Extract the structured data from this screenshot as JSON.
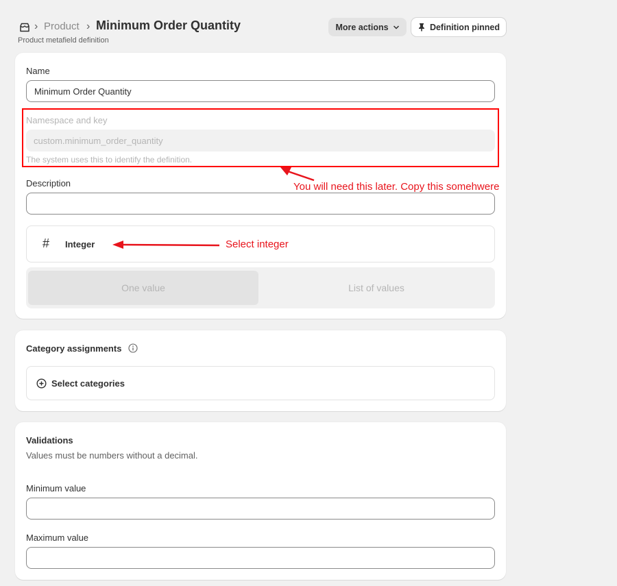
{
  "header": {
    "breadcrumb": "Product",
    "title": "Minimum Order Quantity",
    "subtitle": "Product metafield definition",
    "more_actions": "More actions",
    "pin_button": "Definition pinned"
  },
  "definition": {
    "name_label": "Name",
    "name_value": "Minimum Order Quantity",
    "namespace_label": "Namespace and key",
    "namespace_value": "custom.minimum_order_quantity",
    "namespace_help": "The system uses this to identify the definition.",
    "description_label": "Description",
    "description_value": "",
    "type_label": "Integer",
    "option_one": "One value",
    "option_list": "List of values"
  },
  "category": {
    "title": "Category assignments",
    "select_label": "Select categories"
  },
  "validations": {
    "title": "Validations",
    "description": "Values must be numbers without a decimal.",
    "min_label": "Minimum value",
    "min_value": "",
    "max_label": "Maximum value",
    "max_value": ""
  },
  "annotations": {
    "copy_note": "You will need this later. Copy this somehwere",
    "select_note": "Select integer",
    "color": "#e8141c"
  },
  "icons": {
    "store": "store-icon",
    "pin": "pin-icon",
    "chevron": "chevron-down-icon",
    "hash": "hash-icon",
    "plus_circle": "plus-circle-icon",
    "info": "info-icon"
  }
}
